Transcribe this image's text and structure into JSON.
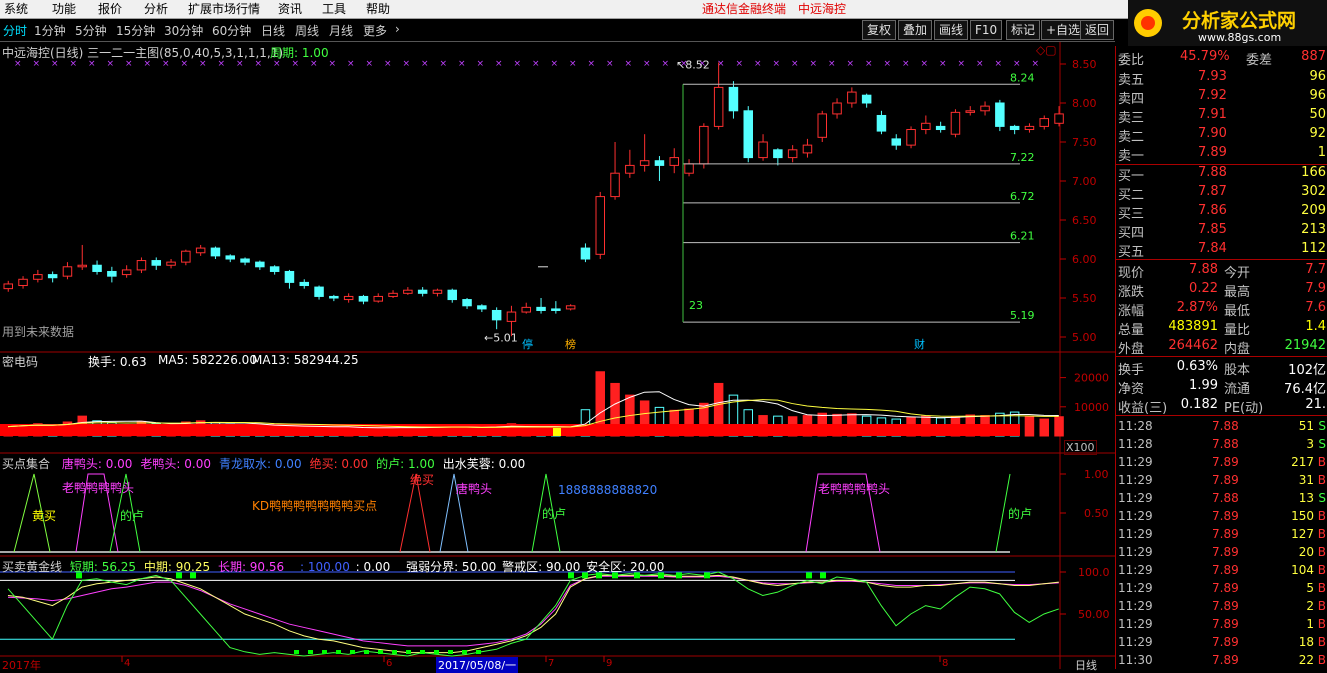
{
  "menu": {
    "items": [
      "系统",
      "功能",
      "报价",
      "分析",
      "扩展市场行情",
      "资讯",
      "工具",
      "帮助"
    ],
    "center_title": "通达信金融终端",
    "stock_name": "中远海控"
  },
  "timeframes": [
    "分时",
    "1分钟",
    "5分钟",
    "15分钟",
    "30分钟",
    "60分钟",
    "日线",
    "周线",
    "月线",
    "更多"
  ],
  "toolbar_buttons": [
    "复权",
    "叠加",
    "画线",
    "F10",
    "标记",
    "+自选",
    "返回"
  ],
  "logo": {
    "main": "分析家公式网",
    "url": "www.88gs.com"
  },
  "main_chart": {
    "title": "中远海控(日线) 三一二一主图(85,0,40,5,3,1,1,1,1)",
    "period_label": "周期: 1.00",
    "note": "用到未来数据",
    "y_ticks": [
      "8.50",
      "8.00",
      "7.50",
      "7.00",
      "6.50",
      "6.00",
      "5.50",
      "5.00"
    ],
    "high_label": "8.52",
    "low_label": "5.01",
    "fib_levels": [
      "8.24",
      "7.22",
      "6.72",
      "6.21",
      "5.19"
    ],
    "count_label": "23",
    "markers": [
      "停",
      "榜",
      "财"
    ]
  },
  "volume_panel": {
    "name": "密电码",
    "turnover": "换手: 0.63",
    "ma5": "MA5: 582226.00",
    "ma13": "MA13: 582944.25",
    "y_ticks": [
      "20000",
      "10000"
    ],
    "unit": "X100"
  },
  "buy_panel": {
    "name": "买点集合",
    "legend": [
      {
        "label": "唐鸭头: 0.00",
        "color": "#ff40ff"
      },
      {
        "label": "老鸭头: 0.00",
        "color": "#ff40ff"
      },
      {
        "label": "青龙取水: 0.00",
        "color": "#4080ff"
      },
      {
        "label": "绝买: 0.00",
        "color": "#ff3030"
      },
      {
        "label": "的卢: 1.00",
        "color": "#40ff40"
      },
      {
        "label": "出水芙蓉: 0.00",
        "color": "#ffffff"
      }
    ],
    "y_ticks": [
      "1.00",
      "0.50"
    ],
    "signal_labels": [
      {
        "text": "黄买",
        "color": "#ffff00"
      },
      {
        "text": "老鸭鸭鸭鸭头",
        "color": "#ff40ff"
      },
      {
        "text": "的卢",
        "color": "#40ff40"
      },
      {
        "text": "KD鸭鸭鸭鸭鸭鸭鸭买点",
        "color": "#ff8000"
      },
      {
        "text": "绝买",
        "color": "#ff3030"
      },
      {
        "text": "唐鸭头",
        "color": "#ff40ff"
      },
      {
        "text": "1888888888820",
        "color": "#4080ff"
      },
      {
        "text": "的卢",
        "color": "#40ff40"
      },
      {
        "text": "老鸭鸭鸭鸭头",
        "color": "#ff40ff"
      },
      {
        "text": "的卢",
        "color": "#40ff40"
      }
    ]
  },
  "gold_panel": {
    "name": "买卖黄金线",
    "short": "短期: 56.25",
    "mid": "中期: 90.25",
    "long": "长期: 90.56",
    "v100": ": 100.00",
    "v0": ": 0.00",
    "strong": "强弱分界: 50.00",
    "warn": "警戒区: 90.00",
    "safe": "安全区: 20.00",
    "y_ticks": [
      "100.0",
      "50.00"
    ]
  },
  "date_axis": {
    "year_label": "2017年",
    "selected_date": "2017/05/08/一",
    "ticks": [
      "4",
      "6",
      "7",
      "9",
      "8"
    ],
    "right_label": "日线"
  },
  "quote": {
    "top": {
      "label": "委比",
      "value": "45.79%",
      "label2": "委差",
      "value2": "887"
    },
    "asks": [
      {
        "label": "卖五",
        "price": "7.93",
        "vol": "96"
      },
      {
        "label": "卖四",
        "price": "7.92",
        "vol": "96"
      },
      {
        "label": "卖三",
        "price": "7.91",
        "vol": "50"
      },
      {
        "label": "卖二",
        "price": "7.90",
        "vol": "92"
      },
      {
        "label": "卖一",
        "price": "7.89",
        "vol": "1"
      }
    ],
    "bids": [
      {
        "label": "买一",
        "price": "7.88",
        "vol": "166"
      },
      {
        "label": "买二",
        "price": "7.87",
        "vol": "302"
      },
      {
        "label": "买三",
        "price": "7.86",
        "vol": "209"
      },
      {
        "label": "买四",
        "price": "7.85",
        "vol": "213"
      },
      {
        "label": "买五",
        "price": "7.84",
        "vol": "112"
      }
    ],
    "stats": [
      {
        "l1": "现价",
        "v1": "7.88",
        "c1": "#ff3030",
        "l2": "今开",
        "v2": "7.7",
        "c2": "#ff3030"
      },
      {
        "l1": "涨跌",
        "v1": "0.22",
        "c1": "#ff3030",
        "l2": "最高",
        "v2": "7.9",
        "c2": "#ff3030"
      },
      {
        "l1": "涨幅",
        "v1": "2.87%",
        "c1": "#ff3030",
        "l2": "最低",
        "v2": "7.6",
        "c2": "#ff3030"
      },
      {
        "l1": "总量",
        "v1": "483891",
        "c1": "#ffff00",
        "l2": "量比",
        "v2": "1.4",
        "c2": "#ffff00"
      },
      {
        "l1": "外盘",
        "v1": "264462",
        "c1": "#ff3030",
        "l2": "内盘",
        "v2": "21942",
        "c2": "#40ff40"
      }
    ],
    "stats2": [
      {
        "l1": "换手",
        "v1": "0.63%",
        "l2": "股本",
        "v2": "102亿"
      },
      {
        "l1": "净资",
        "v1": "1.99",
        "l2": "流通",
        "v2": "76.4亿"
      },
      {
        "l1": "收益(三)",
        "v1": "0.182",
        "l2": "PE(动)",
        "v2": "21."
      }
    ],
    "ticks": [
      {
        "t": "11:28",
        "p": "7.88",
        "v": "51",
        "d": "S"
      },
      {
        "t": "11:28",
        "p": "7.88",
        "v": "3",
        "d": "S"
      },
      {
        "t": "11:29",
        "p": "7.89",
        "v": "217",
        "d": "B"
      },
      {
        "t": "11:29",
        "p": "7.89",
        "v": "31",
        "d": "B"
      },
      {
        "t": "11:29",
        "p": "7.88",
        "v": "13",
        "d": "S"
      },
      {
        "t": "11:29",
        "p": "7.89",
        "v": "150",
        "d": "B"
      },
      {
        "t": "11:29",
        "p": "7.89",
        "v": "127",
        "d": "B"
      },
      {
        "t": "11:29",
        "p": "7.89",
        "v": "20",
        "d": "B"
      },
      {
        "t": "11:29",
        "p": "7.89",
        "v": "104",
        "d": "B"
      },
      {
        "t": "11:29",
        "p": "7.89",
        "v": "5",
        "d": "B"
      },
      {
        "t": "11:29",
        "p": "7.89",
        "v": "2",
        "d": "B"
      },
      {
        "t": "11:29",
        "p": "7.89",
        "v": "1",
        "d": "B"
      },
      {
        "t": "11:29",
        "p": "7.89",
        "v": "18",
        "d": "B"
      },
      {
        "t": "11:30",
        "p": "7.89",
        "v": "22",
        "d": "B"
      }
    ]
  }
}
